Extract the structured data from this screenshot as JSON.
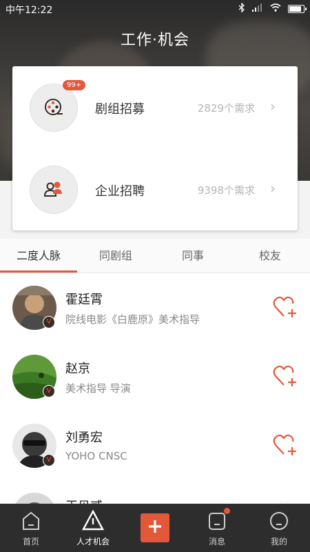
{
  "status_bar": {
    "time": "中午12:22",
    "battery_level": 0.9
  },
  "header": {
    "title": "工作·机会"
  },
  "opportunities": [
    {
      "label": "剧组招募",
      "count": "2829个需求",
      "badge": "99+",
      "icon": "film-reel-icon"
    },
    {
      "label": "企业招聘",
      "count": "9398个需求",
      "icon": "people-icon"
    }
  ],
  "tabs": [
    {
      "label": "二度人脉",
      "active": true
    },
    {
      "label": "同剧组"
    },
    {
      "label": "同事"
    },
    {
      "label": "校友"
    }
  ],
  "people": [
    {
      "name": "霍廷霄",
      "desc": "院线电影《白鹿原》美术指导",
      "badge": "V"
    },
    {
      "name": "赵京",
      "desc": "美术指导 导演",
      "badge": "V"
    },
    {
      "name": "刘勇宏",
      "desc": "YOHO CNSC",
      "badge": "V"
    },
    {
      "name": "王贝贰",
      "desc": "",
      "badge": "V"
    }
  ],
  "tabbar": {
    "items": [
      {
        "label": "首页",
        "icon": "home-icon"
      },
      {
        "label": "人才机会",
        "icon": "talent-icon",
        "active": true
      },
      {
        "label": "",
        "icon": "add-icon"
      },
      {
        "label": "消息",
        "icon": "message-icon",
        "has_dot": true
      },
      {
        "label": "我的",
        "icon": "profile-icon"
      }
    ]
  },
  "colors": {
    "accent": "#e4583a",
    "tabbar_bg": "#2d2d2d"
  }
}
